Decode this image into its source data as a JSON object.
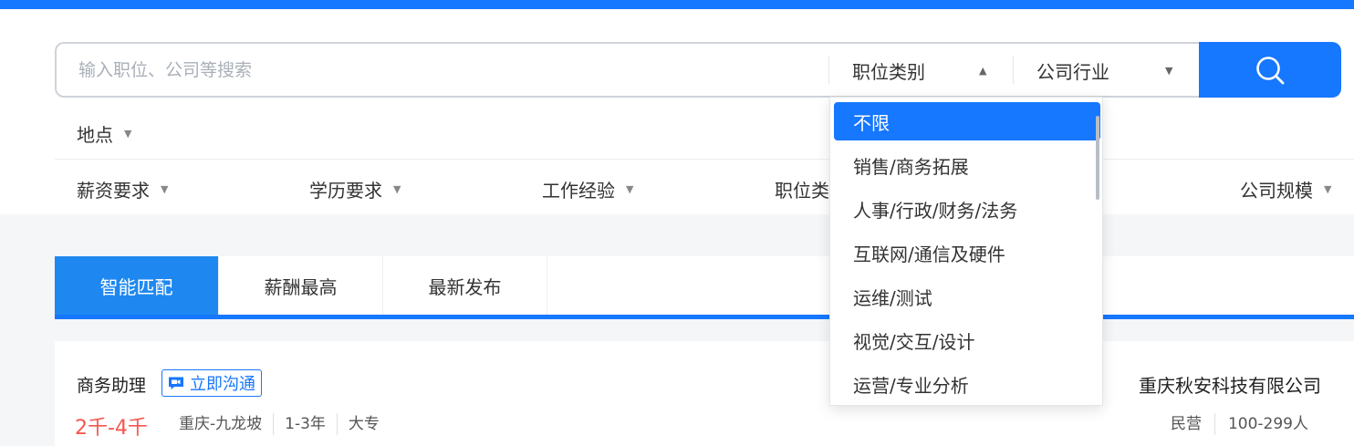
{
  "search": {
    "placeholder": "输入职位、公司等搜索",
    "job_category_label": "职位类别",
    "industry_label": "公司行业",
    "icon": "search-icon"
  },
  "filters": {
    "location": "地点",
    "row": [
      "薪资要求",
      "学历要求",
      "工作经验",
      "职位类",
      "公司规模"
    ]
  },
  "dropdown": {
    "selected": "不限",
    "options": [
      "不限",
      "销售/商务拓展",
      "人事/行政/财务/法务",
      "互联网/通信及硬件",
      "运维/测试",
      "视觉/交互/设计",
      "运营/专业分析"
    ]
  },
  "tabs": [
    {
      "label": "智能匹配",
      "active": true
    },
    {
      "label": "薪酬最高",
      "active": false
    },
    {
      "label": "最新发布",
      "active": false
    }
  ],
  "job": {
    "title": "商务助理",
    "chat_label": "立即沟通",
    "salary": "2千-4千",
    "location": "重庆-九龙坡",
    "experience": "1-3年",
    "education": "大专",
    "company": "重庆秋安科技有限公司",
    "company_type": "民营",
    "company_size": "100-299人"
  },
  "colors": {
    "accent": "#1677ff",
    "active_tab": "#1e88f0",
    "salary": "#f5564f"
  }
}
